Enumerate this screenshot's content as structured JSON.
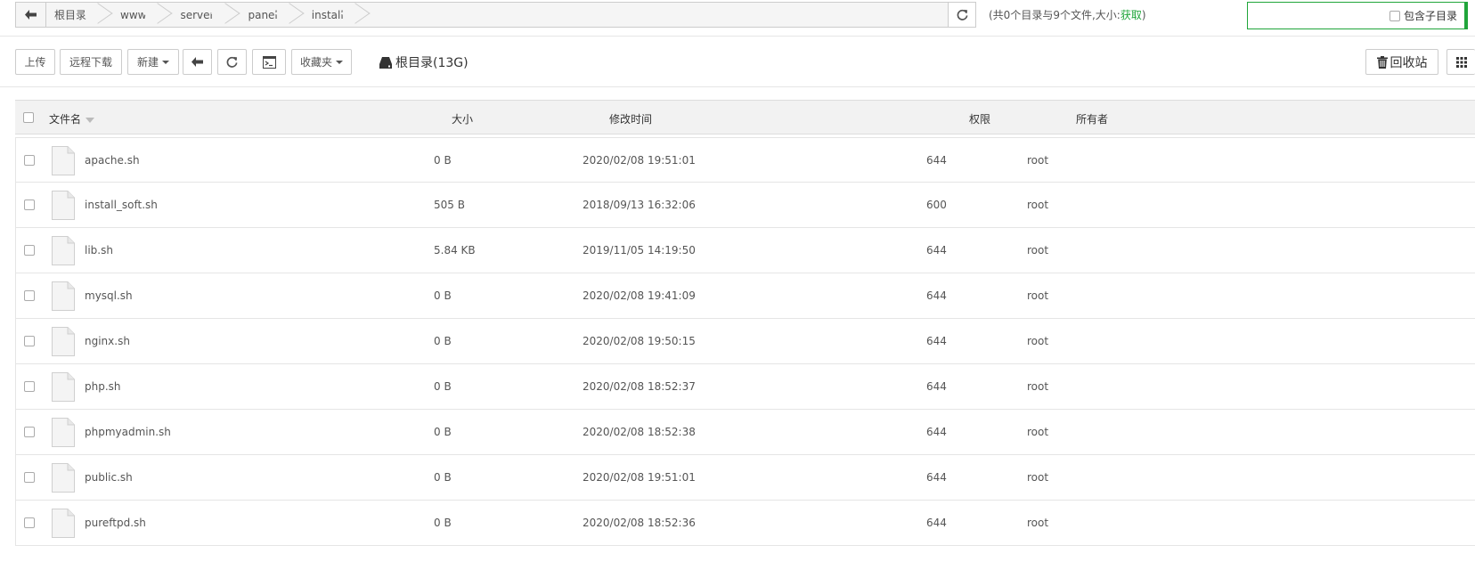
{
  "path": {
    "crumbs": [
      "根目录",
      "www",
      "server",
      "panel",
      "install"
    ]
  },
  "counts": {
    "text": "(共0个目录与9个文件,大小:",
    "get_label": "获取",
    "close": ")"
  },
  "search": {
    "placeholder": "",
    "include_subdir_label": "包含子目录"
  },
  "toolbar": {
    "upload": "上传",
    "remote_download": "远程下载",
    "new": "新建",
    "favorites": "收藏夹",
    "disk_label": "根目录(13G)",
    "recycle_bin": "回收站"
  },
  "table": {
    "headers": {
      "name": "文件名",
      "size": "大小",
      "mtime": "修改时间",
      "perm": "权限",
      "owner": "所有者"
    },
    "rows": [
      {
        "name": "apache.sh",
        "size": "0 B",
        "mtime": "2020/02/08 19:51:01",
        "perm": "644",
        "owner": "root"
      },
      {
        "name": "install_soft.sh",
        "size": "505 B",
        "mtime": "2018/09/13 16:32:06",
        "perm": "600",
        "owner": "root"
      },
      {
        "name": "lib.sh",
        "size": "5.84 KB",
        "mtime": "2019/11/05 14:19:50",
        "perm": "644",
        "owner": "root"
      },
      {
        "name": "mysql.sh",
        "size": "0 B",
        "mtime": "2020/02/08 19:41:09",
        "perm": "644",
        "owner": "root"
      },
      {
        "name": "nginx.sh",
        "size": "0 B",
        "mtime": "2020/02/08 19:50:15",
        "perm": "644",
        "owner": "root"
      },
      {
        "name": "php.sh",
        "size": "0 B",
        "mtime": "2020/02/08 18:52:37",
        "perm": "644",
        "owner": "root"
      },
      {
        "name": "phpmyadmin.sh",
        "size": "0 B",
        "mtime": "2020/02/08 18:52:38",
        "perm": "644",
        "owner": "root"
      },
      {
        "name": "public.sh",
        "size": "0 B",
        "mtime": "2020/02/08 19:51:01",
        "perm": "644",
        "owner": "root"
      },
      {
        "name": "pureftpd.sh",
        "size": "0 B",
        "mtime": "2020/02/08 18:52:36",
        "perm": "644",
        "owner": "root"
      }
    ]
  },
  "colors": {
    "accent": "#20a53a",
    "border": "#cccccc",
    "header_bg": "#f2f2f2"
  },
  "icons": [
    "arrow-left-icon",
    "refresh-icon",
    "terminal-icon",
    "hdd-icon",
    "trash-icon",
    "grid-icon",
    "file-icon"
  ]
}
